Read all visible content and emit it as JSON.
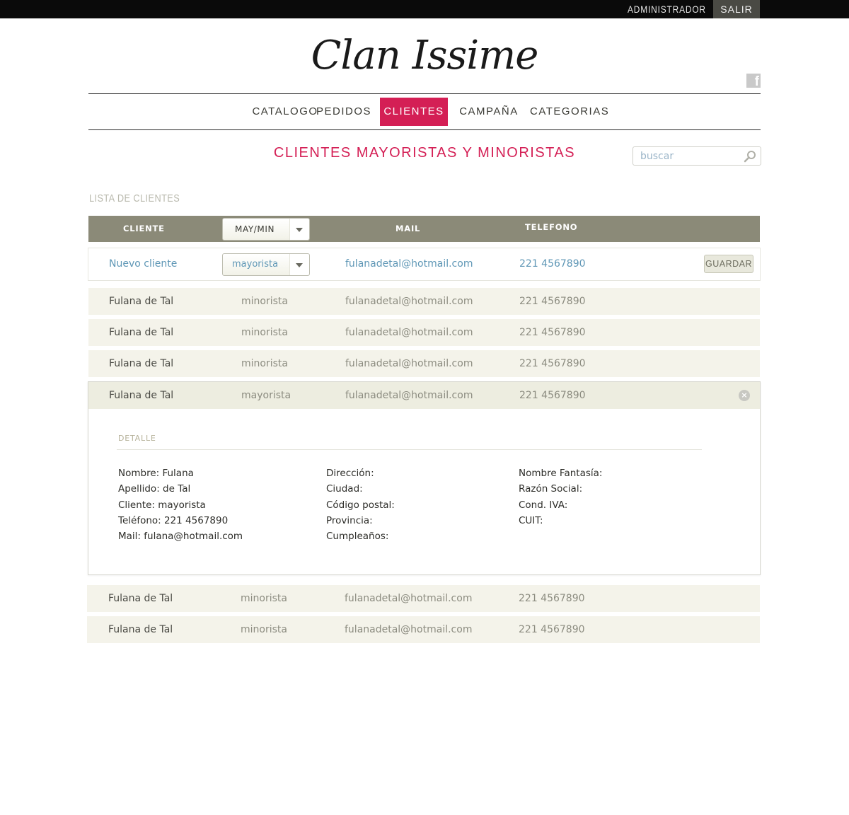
{
  "topbar": {
    "admin_label": "ADMINISTRADOR",
    "logout_label": "SALIR"
  },
  "brand": {
    "logo_text": "Clan Issime"
  },
  "nav": {
    "items": [
      {
        "label": "CATALOGO"
      },
      {
        "label": "PEDIDOS"
      },
      {
        "label": "CLIENTES"
      },
      {
        "label": "CAMPAÑA"
      },
      {
        "label": "CATEGORIAS"
      }
    ],
    "active": "CLIENTES"
  },
  "page": {
    "title": "CLIENTES MAYORISTAS Y MINORISTAS"
  },
  "search": {
    "placeholder": "buscar",
    "value": ""
  },
  "list": {
    "title": "LISTA DE CLIENTES",
    "columns": {
      "cliente": "CLIENTE",
      "type_filter": "MAY/MIN",
      "mail": "MAIL",
      "telefono": "TELEFONO"
    }
  },
  "new_client": {
    "name": "Nuevo cliente",
    "type": "mayorista",
    "mail": "fulanadetal@hotmail.com",
    "phone": "221 4567890",
    "save_label": "GUARDAR"
  },
  "rows": [
    {
      "name": "Fulana de Tal",
      "type": "minorista",
      "mail": "fulanadetal@hotmail.com",
      "phone": "221 4567890"
    },
    {
      "name": "Fulana de Tal",
      "type": "minorista",
      "mail": "fulanadetal@hotmail.com",
      "phone": "221 4567890"
    },
    {
      "name": "Fulana de Tal",
      "type": "minorista",
      "mail": "fulanadetal@hotmail.com",
      "phone": "221 4567890"
    },
    {
      "name": "Fulana de Tal",
      "type": "mayorista",
      "mail": "fulanadetal@hotmail.com",
      "phone": "221 4567890"
    },
    {
      "name": "Fulana de Tal",
      "type": "minorista",
      "mail": "fulanadetal@hotmail.com",
      "phone": "221 4567890"
    },
    {
      "name": "Fulana de Tal",
      "type": "minorista",
      "mail": "fulanadetal@hotmail.com",
      "phone": "221 4567890"
    }
  ],
  "detail": {
    "label": "DETALLE",
    "col1": [
      "Nombre: Fulana",
      "Apellido: de Tal",
      "Cliente: mayorista",
      "Teléfono: 221 4567890",
      "Mail: fulana@hotmail.com"
    ],
    "col2": [
      "Dirección:",
      "Ciudad:",
      "Código postal:",
      "Provincia:",
      "Cumpleaños:"
    ],
    "col3": [
      "Nombre Fantasía:",
      "Razón Social:",
      "Cond. IVA:",
      "CUIT:"
    ]
  },
  "colors": {
    "accent": "#d41f55",
    "header_bg": "#8b8a78",
    "row_bg": "#f4f3ea",
    "link": "#5f97b6"
  },
  "icons": [
    "facebook-icon",
    "search-icon",
    "dropdown-arrow-icon",
    "close-icon"
  ]
}
